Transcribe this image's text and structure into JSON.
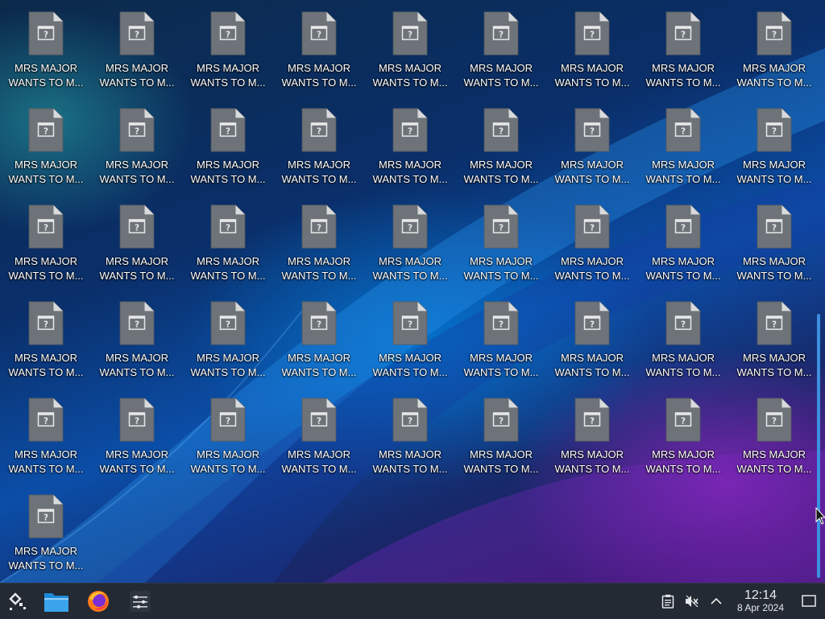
{
  "desktop": {
    "icon_label_line1": "MRS MAJOR",
    "icon_label_line2": "WANTS TO M...",
    "icons": [
      {
        "line1": "MRS MAJOR",
        "line2": "WANTS TO M..."
      },
      {
        "line1": "MRS MAJOR",
        "line2": "WANTS TO M..."
      },
      {
        "line1": "MRS MAJOR",
        "line2": "WANTS TO M..."
      },
      {
        "line1": "MRS MAJOR",
        "line2": "WANTS TO M..."
      },
      {
        "line1": "MRS MAJOR",
        "line2": "WANTS TO M..."
      },
      {
        "line1": "MRS MAJOR",
        "line2": "WANTS TO M..."
      },
      {
        "line1": "MRS MAJOR",
        "line2": "WANTS TO M..."
      },
      {
        "line1": "MRS MAJOR",
        "line2": "WANTS TO M..."
      },
      {
        "line1": "MRS MAJOR",
        "line2": "WANTS TO M..."
      },
      {
        "line1": "MRS MAJOR",
        "line2": "WANTS TO M..."
      },
      {
        "line1": "MRS MAJOR",
        "line2": "WANTS TO M..."
      },
      {
        "line1": "MRS MAJOR",
        "line2": "WANTS TO M..."
      },
      {
        "line1": "MRS MAJOR",
        "line2": "WANTS TO M..."
      },
      {
        "line1": "MRS MAJOR",
        "line2": "WANTS TO M..."
      },
      {
        "line1": "MRS MAJOR",
        "line2": "WANTS TO M..."
      },
      {
        "line1": "MRS MAJOR",
        "line2": "WANTS TO M..."
      },
      {
        "line1": "MRS MAJOR",
        "line2": "WANTS TO M..."
      },
      {
        "line1": "MRS MAJOR",
        "line2": "WANTS TO M..."
      },
      {
        "line1": "MRS MAJOR",
        "line2": "WANTS TO M..."
      },
      {
        "line1": "MRS MAJOR",
        "line2": "WANTS TO M..."
      },
      {
        "line1": "MRS MAJOR",
        "line2": "WANTS TO M..."
      },
      {
        "line1": "MRS MAJOR",
        "line2": "WANTS TO M..."
      },
      {
        "line1": "MRS MAJOR",
        "line2": "WANTS TO M..."
      },
      {
        "line1": "MRS MAJOR",
        "line2": "WANTS TO M..."
      },
      {
        "line1": "MRS MAJOR",
        "line2": "WANTS TO M..."
      },
      {
        "line1": "MRS MAJOR",
        "line2": "WANTS TO M..."
      },
      {
        "line1": "MRS MAJOR",
        "line2": "WANTS TO M..."
      },
      {
        "line1": "MRS MAJOR",
        "line2": "WANTS TO M..."
      },
      {
        "line1": "MRS MAJOR",
        "line2": "WANTS TO M..."
      },
      {
        "line1": "MRS MAJOR",
        "line2": "WANTS TO M..."
      },
      {
        "line1": "MRS MAJOR",
        "line2": "WANTS TO M..."
      },
      {
        "line1": "MRS MAJOR",
        "line2": "WANTS TO M..."
      },
      {
        "line1": "MRS MAJOR",
        "line2": "WANTS TO M..."
      },
      {
        "line1": "MRS MAJOR",
        "line2": "WANTS TO M..."
      },
      {
        "line1": "MRS MAJOR",
        "line2": "WANTS TO M..."
      },
      {
        "line1": "MRS MAJOR",
        "line2": "WANTS TO M..."
      },
      {
        "line1": "MRS MAJOR",
        "line2": "WANTS TO M..."
      },
      {
        "line1": "MRS MAJOR",
        "line2": "WANTS TO M..."
      },
      {
        "line1": "MRS MAJOR",
        "line2": "WANTS TO M..."
      },
      {
        "line1": "MRS MAJOR",
        "line2": "WANTS TO M..."
      },
      {
        "line1": "MRS MAJOR",
        "line2": "WANTS TO M..."
      },
      {
        "line1": "MRS MAJOR",
        "line2": "WANTS TO M..."
      },
      {
        "line1": "MRS MAJOR",
        "line2": "WANTS TO M..."
      },
      {
        "line1": "MRS MAJOR",
        "line2": "WANTS TO M..."
      },
      {
        "line1": "MRS MAJOR",
        "line2": "WANTS TO M..."
      },
      {
        "line1": "MRS MAJOR",
        "line2": "WANTS TO M..."
      }
    ],
    "icon_type": "unknown-file-icon",
    "scrollbar_color": "#3d8fe0"
  },
  "taskbar": {
    "items": [
      {
        "name": "application-launcher",
        "icon": "kde-launcher-icon"
      },
      {
        "name": "file-manager",
        "icon": "folder-icon"
      },
      {
        "name": "firefox",
        "icon": "firefox-icon"
      },
      {
        "name": "system-settings",
        "icon": "settings-sliders-icon"
      }
    ],
    "tray": {
      "icons": [
        "clipboard-icon",
        "volume-muted-icon",
        "chevron-up-icon"
      ],
      "time": "12:14",
      "date": "8 Apr 2024"
    },
    "background_color": "#232a33"
  }
}
